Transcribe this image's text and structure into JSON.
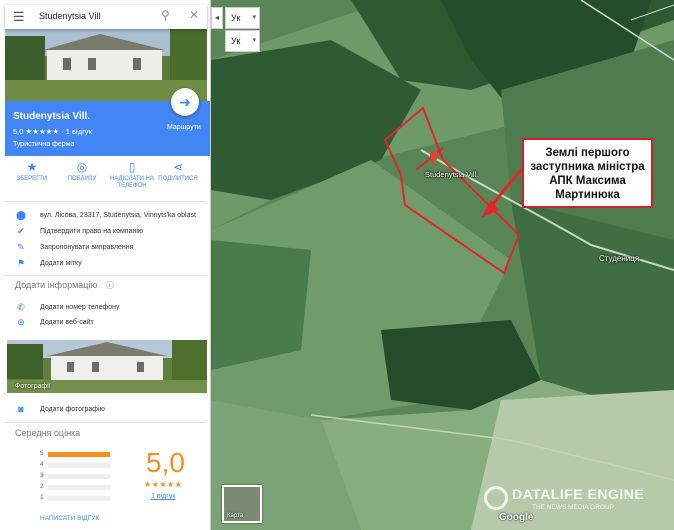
{
  "search": {
    "query": "Studenytsia Vill"
  },
  "place": {
    "name": "Studenytsia Vill.",
    "rating_line": "5,0 ★★★★★ · 1 відгук",
    "type": "Туристична ферма",
    "directions_label": "Маршрути"
  },
  "actions": [
    {
      "label": "ЗБЕРЕГТИ",
      "icon": "star-icon"
    },
    {
      "label": "ПОБЛИЗУ",
      "icon": "nearby-icon"
    },
    {
      "label": "НАДІСЛАТИ НА ТЕЛЕФОН",
      "icon": "send-to-phone-icon"
    },
    {
      "label": "ПОДІЛИТИСЯ",
      "icon": "share-icon"
    }
  ],
  "info": [
    {
      "text": "вул. Лісова, 23317, Studenytsia, Vinnyts'ka oblast",
      "icon": "location-icon"
    },
    {
      "text": "Підтвердити право на компанію",
      "icon": "verified-icon"
    },
    {
      "text": "Запропонувати виправлення",
      "icon": "edit-icon"
    },
    {
      "text": "Додати мітку",
      "icon": "flag-icon"
    }
  ],
  "add_info": {
    "title": "Додати інформацію",
    "phone": "Додати номер телефону",
    "website": "Додати веб-сайт"
  },
  "photos": {
    "label": "Фотографії",
    "add_photo": "Додати фотографію"
  },
  "reviews": {
    "title": "Середня оцінка",
    "score": "5,0",
    "stars": "★★★★★",
    "count": "1 відгук",
    "write": "НАПИСАТИ ВІДГУК",
    "bars": [
      {
        "stars": "5",
        "fraction": 1.0
      },
      {
        "stars": "4",
        "fraction": 0.0
      },
      {
        "stars": "3",
        "fraction": 0.0
      },
      {
        "stars": "2",
        "fraction": 0.0
      },
      {
        "stars": "1",
        "fraction": 0.0
      }
    ]
  },
  "map": {
    "lang_top": "Ук",
    "lang_bottom": "Ук",
    "pin_label": "Studenytsia Vill.",
    "village_label": "Студениця",
    "callout": "Землі першого заступника міністра АПК Максима Мартинюка",
    "minimap_label": "Карта",
    "google": "Google",
    "watermark_main": "DATALIFE ENGINE",
    "watermark_sub": "THE NEWS MEDIA GROUP"
  },
  "colors": {
    "accent": "#4285f4",
    "rating": "#f4911e",
    "annotation": "#d21f2a"
  }
}
